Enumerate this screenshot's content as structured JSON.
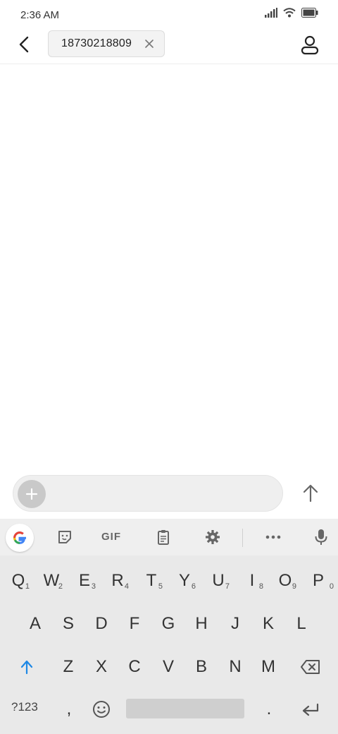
{
  "status_bar": {
    "time": "2:36 AM"
  },
  "header": {
    "recipient": "18730218809"
  },
  "compose": {
    "placeholder": ""
  },
  "keyboard": {
    "toolbar": {
      "gif_label": "GIF"
    },
    "rows": [
      {
        "keys": [
          "Q",
          "W",
          "E",
          "R",
          "T",
          "Y",
          "U",
          "I",
          "O",
          "P"
        ],
        "hints": [
          "1",
          "2",
          "3",
          "4",
          "5",
          "6",
          "7",
          "8",
          "9",
          "0"
        ]
      },
      {
        "keys": [
          "A",
          "S",
          "D",
          "F",
          "G",
          "H",
          "J",
          "K",
          "L"
        ]
      },
      {
        "keys": [
          "Z",
          "X",
          "C",
          "V",
          "B",
          "N",
          "M"
        ]
      }
    ],
    "bottom": {
      "symbols_label": "?123",
      "comma": ",",
      "period": "."
    }
  },
  "colors": {
    "accent": "#1a73e8",
    "shift_blue": "#1e88e5"
  }
}
